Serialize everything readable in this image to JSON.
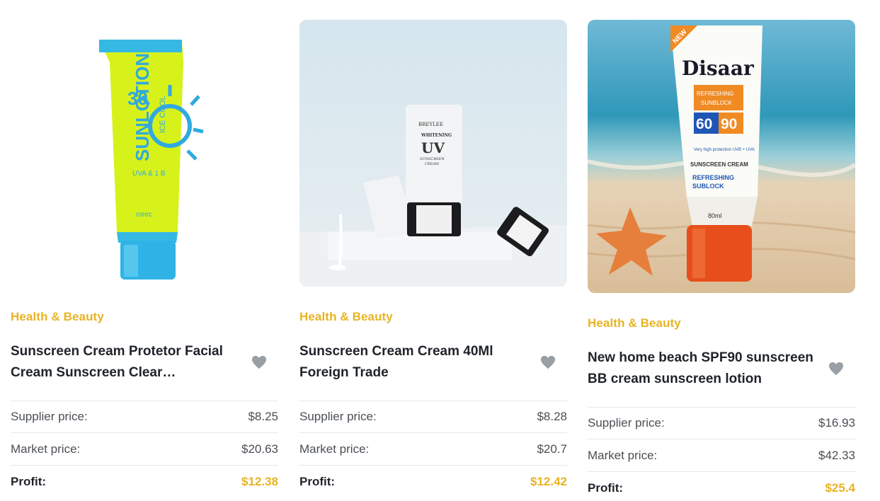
{
  "products": [
    {
      "image_desc": "sunlotion-tube-icon",
      "category": "Health & Beauty",
      "title": "Sunscreen Cream Protetor Facial Cream Sunscreen Clear Moisturizing",
      "supplier_label": "Supplier price:",
      "supplier_price": "$8.25",
      "market_label": "Market price:",
      "market_price": "$20.63",
      "profit_label": "Profit:",
      "profit": "$12.38",
      "tube_text": {
        "spf": "30",
        "line1": "ICE COOL",
        "line2": "SUNLOTION",
        "uva": "UVA & 1B",
        "brand": "rorec"
      }
    },
    {
      "image_desc": "uv-cream-bottle-icon",
      "category": "Health & Beauty",
      "title": "Sunscreen Cream Cream 40Ml Foreign Trade",
      "supplier_label": "Supplier price:",
      "supplier_price": "$8.28",
      "market_label": "Market price:",
      "market_price": "$20.7",
      "profit_label": "Profit:",
      "profit": "$12.42",
      "bottle_text": {
        "brand": "BREYLEE",
        "sub": "WHITENING",
        "big": "UV",
        "line1": "SUNSCREEN",
        "line2": "CREAM"
      }
    },
    {
      "image_desc": "disaar-tube-beach-icon",
      "category": "Health & Beauty",
      "title": "New home beach SPF90 sunscreen BB cream sunscreen lotion",
      "supplier_label": "Supplier price:",
      "supplier_price": "$16.93",
      "market_label": "Market price:",
      "market_price": "$42.33",
      "profit_label": "Profit:",
      "profit": "$25.4",
      "tube_text": {
        "badge": "NEW",
        "brand": "Disaar",
        "refresh": "REFRESHING SUNBLOCK",
        "n1": "60",
        "n2": "90",
        "cream": "SUNSCREEN CREAM",
        "sub": "REFRESHING SUBLOCK",
        "ml": "80ml"
      }
    }
  ],
  "colors": {
    "accent": "#e8b323",
    "heart": "#9a9fa6"
  }
}
